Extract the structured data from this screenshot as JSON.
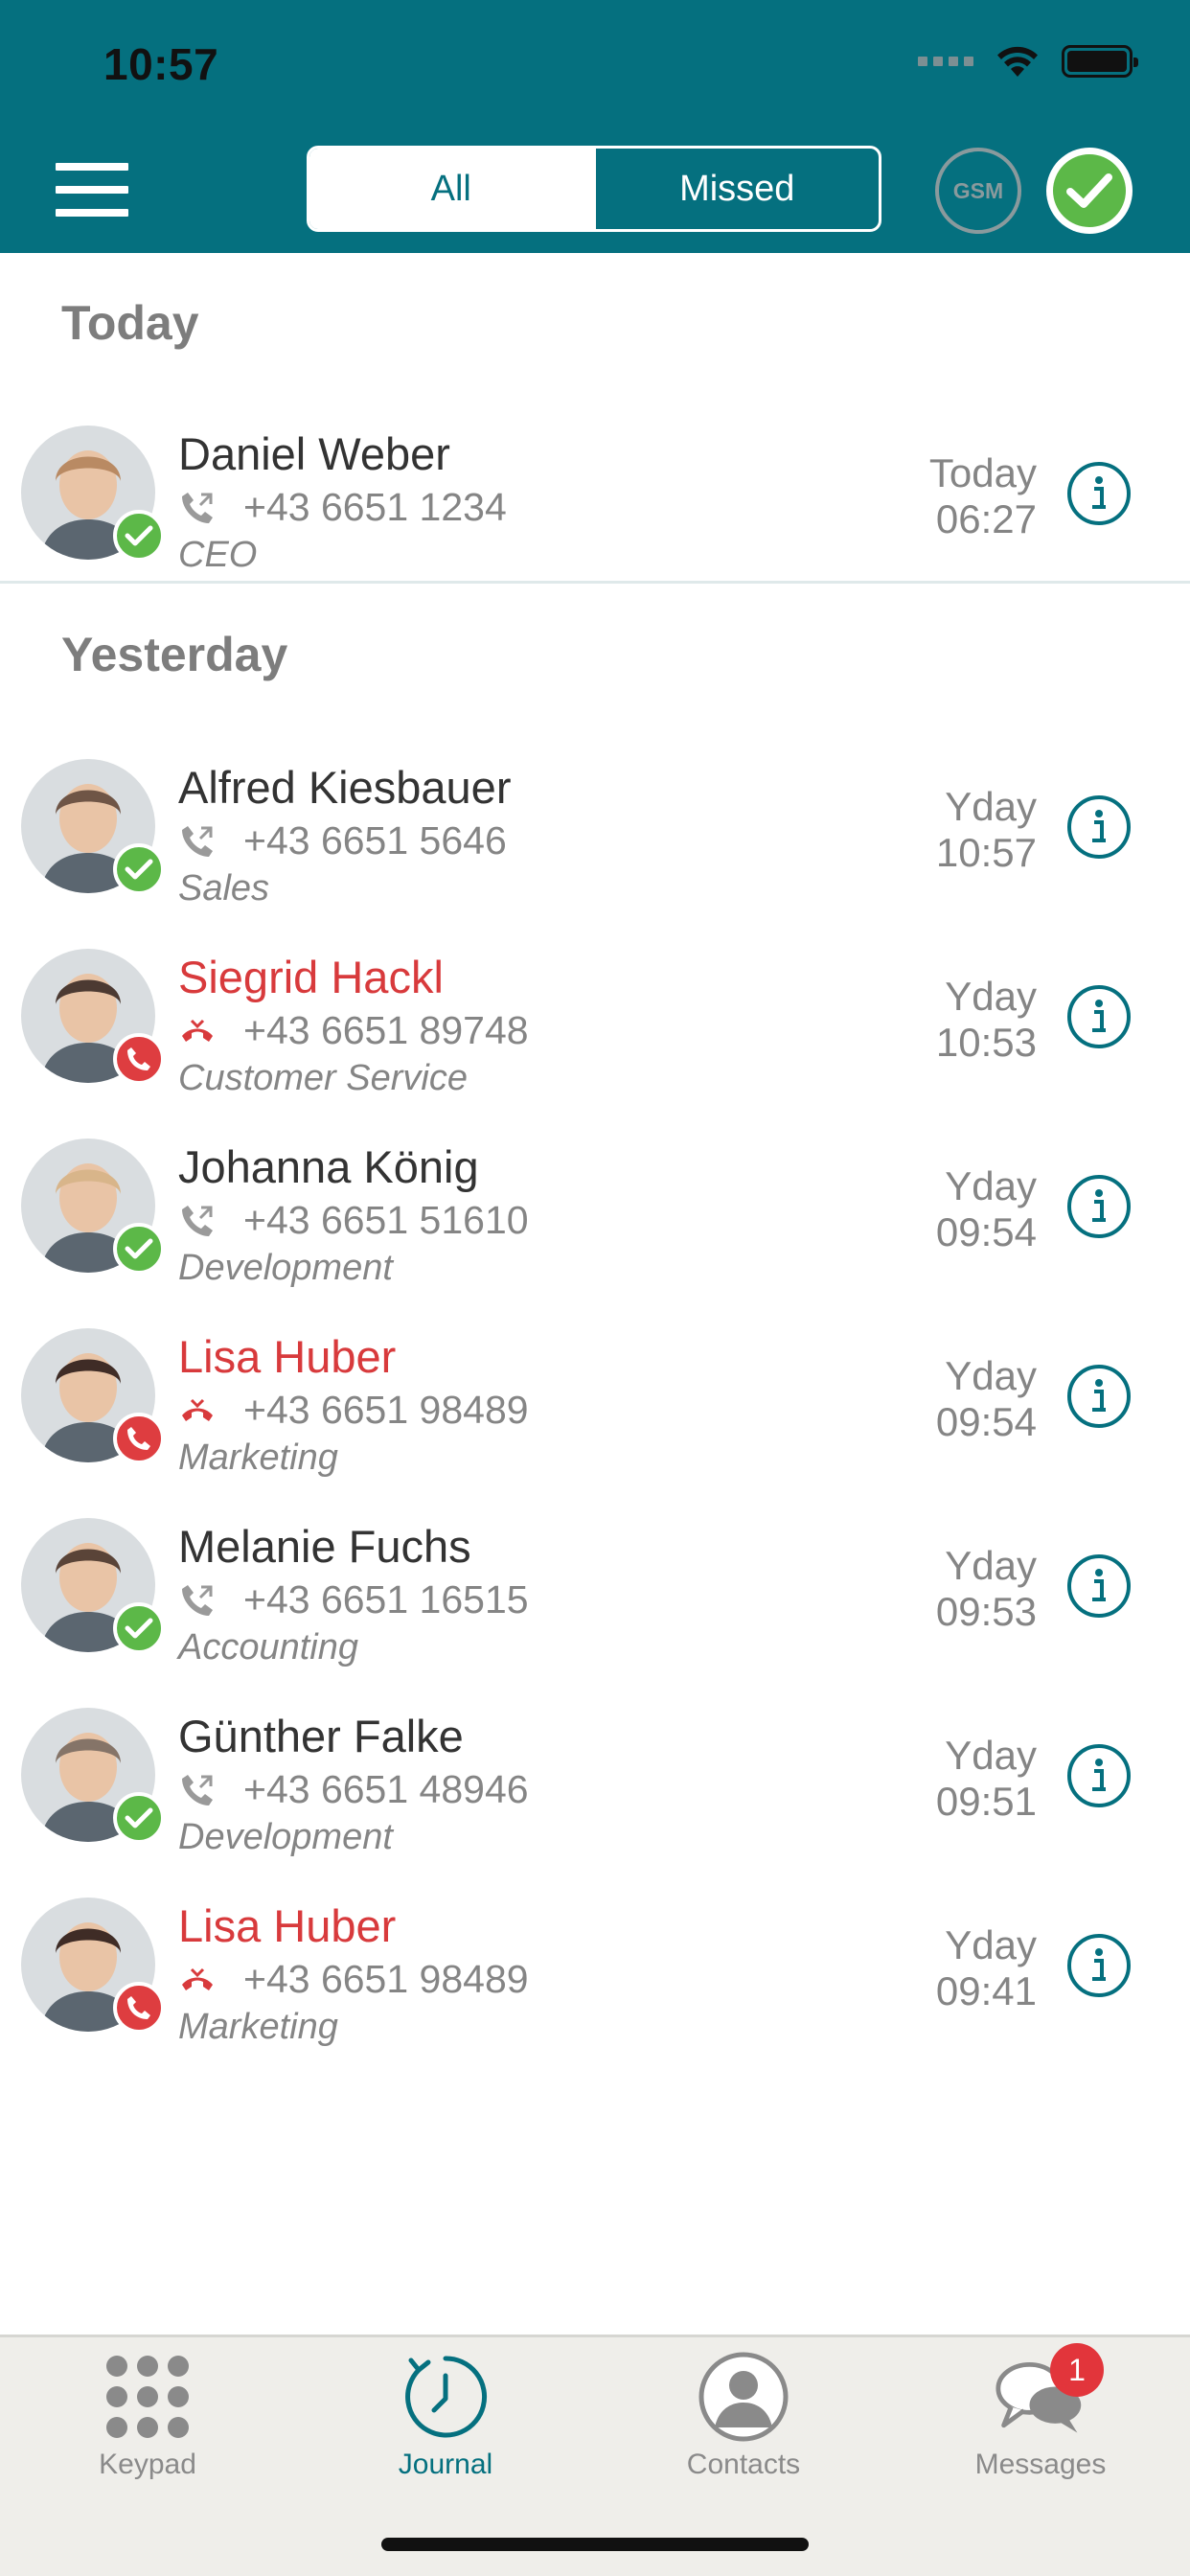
{
  "status_bar": {
    "time": "10:57"
  },
  "header": {
    "filter_tabs": [
      {
        "label": "All",
        "selected": true
      },
      {
        "label": "Missed",
        "selected": false
      }
    ],
    "gsm_label": "GSM"
  },
  "sections": {
    "today": "Today",
    "yesterday": "Yesterday"
  },
  "calls": [
    {
      "name": "Daniel Weber",
      "number": "+43 6651 1234",
      "dept": "CEO",
      "day": "Today",
      "time": "06:27",
      "missed": false
    },
    {
      "name": "Alfred Kiesbauer",
      "number": "+43 6651 5646",
      "dept": "Sales",
      "day": "Yday",
      "time": "10:57",
      "missed": false
    },
    {
      "name": "Siegrid Hackl",
      "number": "+43 6651 89748",
      "dept": "Customer Service",
      "day": "Yday",
      "time": "10:53",
      "missed": true
    },
    {
      "name": "Johanna König",
      "number": "+43 6651 51610",
      "dept": "Development",
      "day": "Yday",
      "time": "09:54",
      "missed": false
    },
    {
      "name": "Lisa Huber",
      "number": "+43 6651 98489",
      "dept": "Marketing",
      "day": "Yday",
      "time": "09:54",
      "missed": true
    },
    {
      "name": "Melanie Fuchs",
      "number": "+43 6651 16515",
      "dept": "Accounting",
      "day": "Yday",
      "time": "09:53",
      "missed": false
    },
    {
      "name": "Günther Falke",
      "number": "+43 6651 48946",
      "dept": "Development",
      "day": "Yday",
      "time": "09:51",
      "missed": false
    },
    {
      "name": "Lisa Huber",
      "number": "+43 6651 98489",
      "dept": "Marketing",
      "day": "Yday",
      "time": "09:41",
      "missed": true
    }
  ],
  "tabbar": {
    "items": [
      {
        "label": "Keypad",
        "icon": "keypad-icon",
        "active": false
      },
      {
        "label": "Journal",
        "icon": "journal-clock-icon",
        "active": true
      },
      {
        "label": "Contacts",
        "icon": "contact-person-icon",
        "active": false
      },
      {
        "label": "Messages",
        "icon": "chat-bubbles-icon",
        "active": false,
        "badge": "1"
      }
    ]
  },
  "colors": {
    "teal": "#05707f",
    "green": "#5cb848",
    "red": "#de3d40",
    "gray_text": "#858585"
  }
}
